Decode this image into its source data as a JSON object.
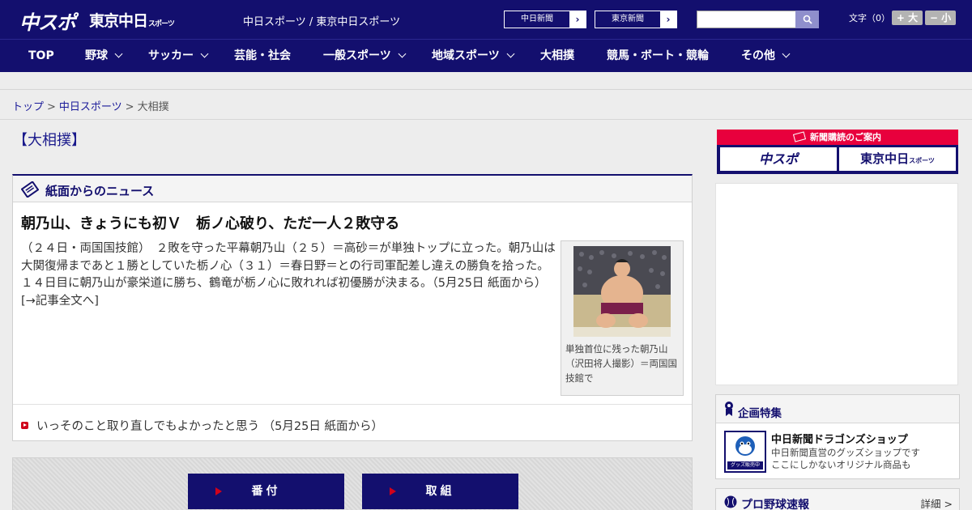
{
  "header": {
    "logo_chuspo": "中スポ",
    "logo_tokyo_main": "東京中日",
    "logo_tokyo_sub": "スポーツ",
    "tagline": "中日スポーツ / 東京中日スポーツ",
    "paper_links": [
      "中日新聞",
      "東京新聞"
    ],
    "search_placeholder": "",
    "fontsize_label": "文字（0）",
    "fontsize_up": "+ 大",
    "fontsize_down": "− 小"
  },
  "nav": {
    "items": [
      {
        "label": "TOP",
        "dropdown": false
      },
      {
        "label": "野球",
        "dropdown": true
      },
      {
        "label": "サッカー",
        "dropdown": true
      },
      {
        "label": "芸能・社会",
        "dropdown": false
      },
      {
        "label": "一般スポーツ",
        "dropdown": true
      },
      {
        "label": "地域スポーツ",
        "dropdown": true
      },
      {
        "label": "大相撲",
        "dropdown": false
      },
      {
        "label": "競馬・ボート・競輪",
        "dropdown": false
      },
      {
        "label": "その他",
        "dropdown": true
      }
    ]
  },
  "breadcrumb": {
    "home": "トップ",
    "section": "中日スポーツ",
    "current": "大相撲",
    "separator": ">"
  },
  "category_title": "【大相撲】",
  "news": {
    "panel_title": "紙面からのニュース",
    "headline": "朝乃山、きょうにも初Ｖ　栃ノ心破り、ただ一人２敗守る",
    "body": "（２４日・両国国技館）　２敗を守った平幕朝乃山（２５）＝高砂＝が単独トップに立った。朝乃山は大関復帰まであと１勝としていた栃ノ心（３１）＝春日野＝との行司軍配差し違えの勝負を拾った。１４日目に朝乃山が豪栄道に勝ち、鶴竜が栃ノ心に敗れれば初優勝が決まる。（5月25日 紙面から）",
    "more_link": "[→記事全文へ]",
    "photo_caption": "単独首位に残った朝乃山（沢田将人撮影）＝両国国技館で",
    "sub_item": "いっそのこと取り直しでもよかったと思う （5月25日 紙面から）"
  },
  "buttons": {
    "banzuke": "番付",
    "torikumi": "取組"
  },
  "sidebar": {
    "subscribe_title": "新聞購読のご案内",
    "subscribe_logo_1": "中スポ",
    "subscribe_logo_2": "東京中日",
    "subscribe_logo_2_sub": "スポーツ",
    "feature_title": "企画特集",
    "goods_title": "中日新聞ドラゴンズショップ",
    "goods_desc_1": "中日新聞直営のグッズショップです",
    "goods_desc_2": "ここにしかないオリジナル商品も",
    "goods_badge": "グッズ販売中",
    "baseball_title": "プロ野球速報",
    "baseball_more": "詳細 >"
  },
  "colors": {
    "brand_navy": "#130f6e",
    "accent_red": "#d0021b",
    "subscribe_red": "#e8003d"
  }
}
